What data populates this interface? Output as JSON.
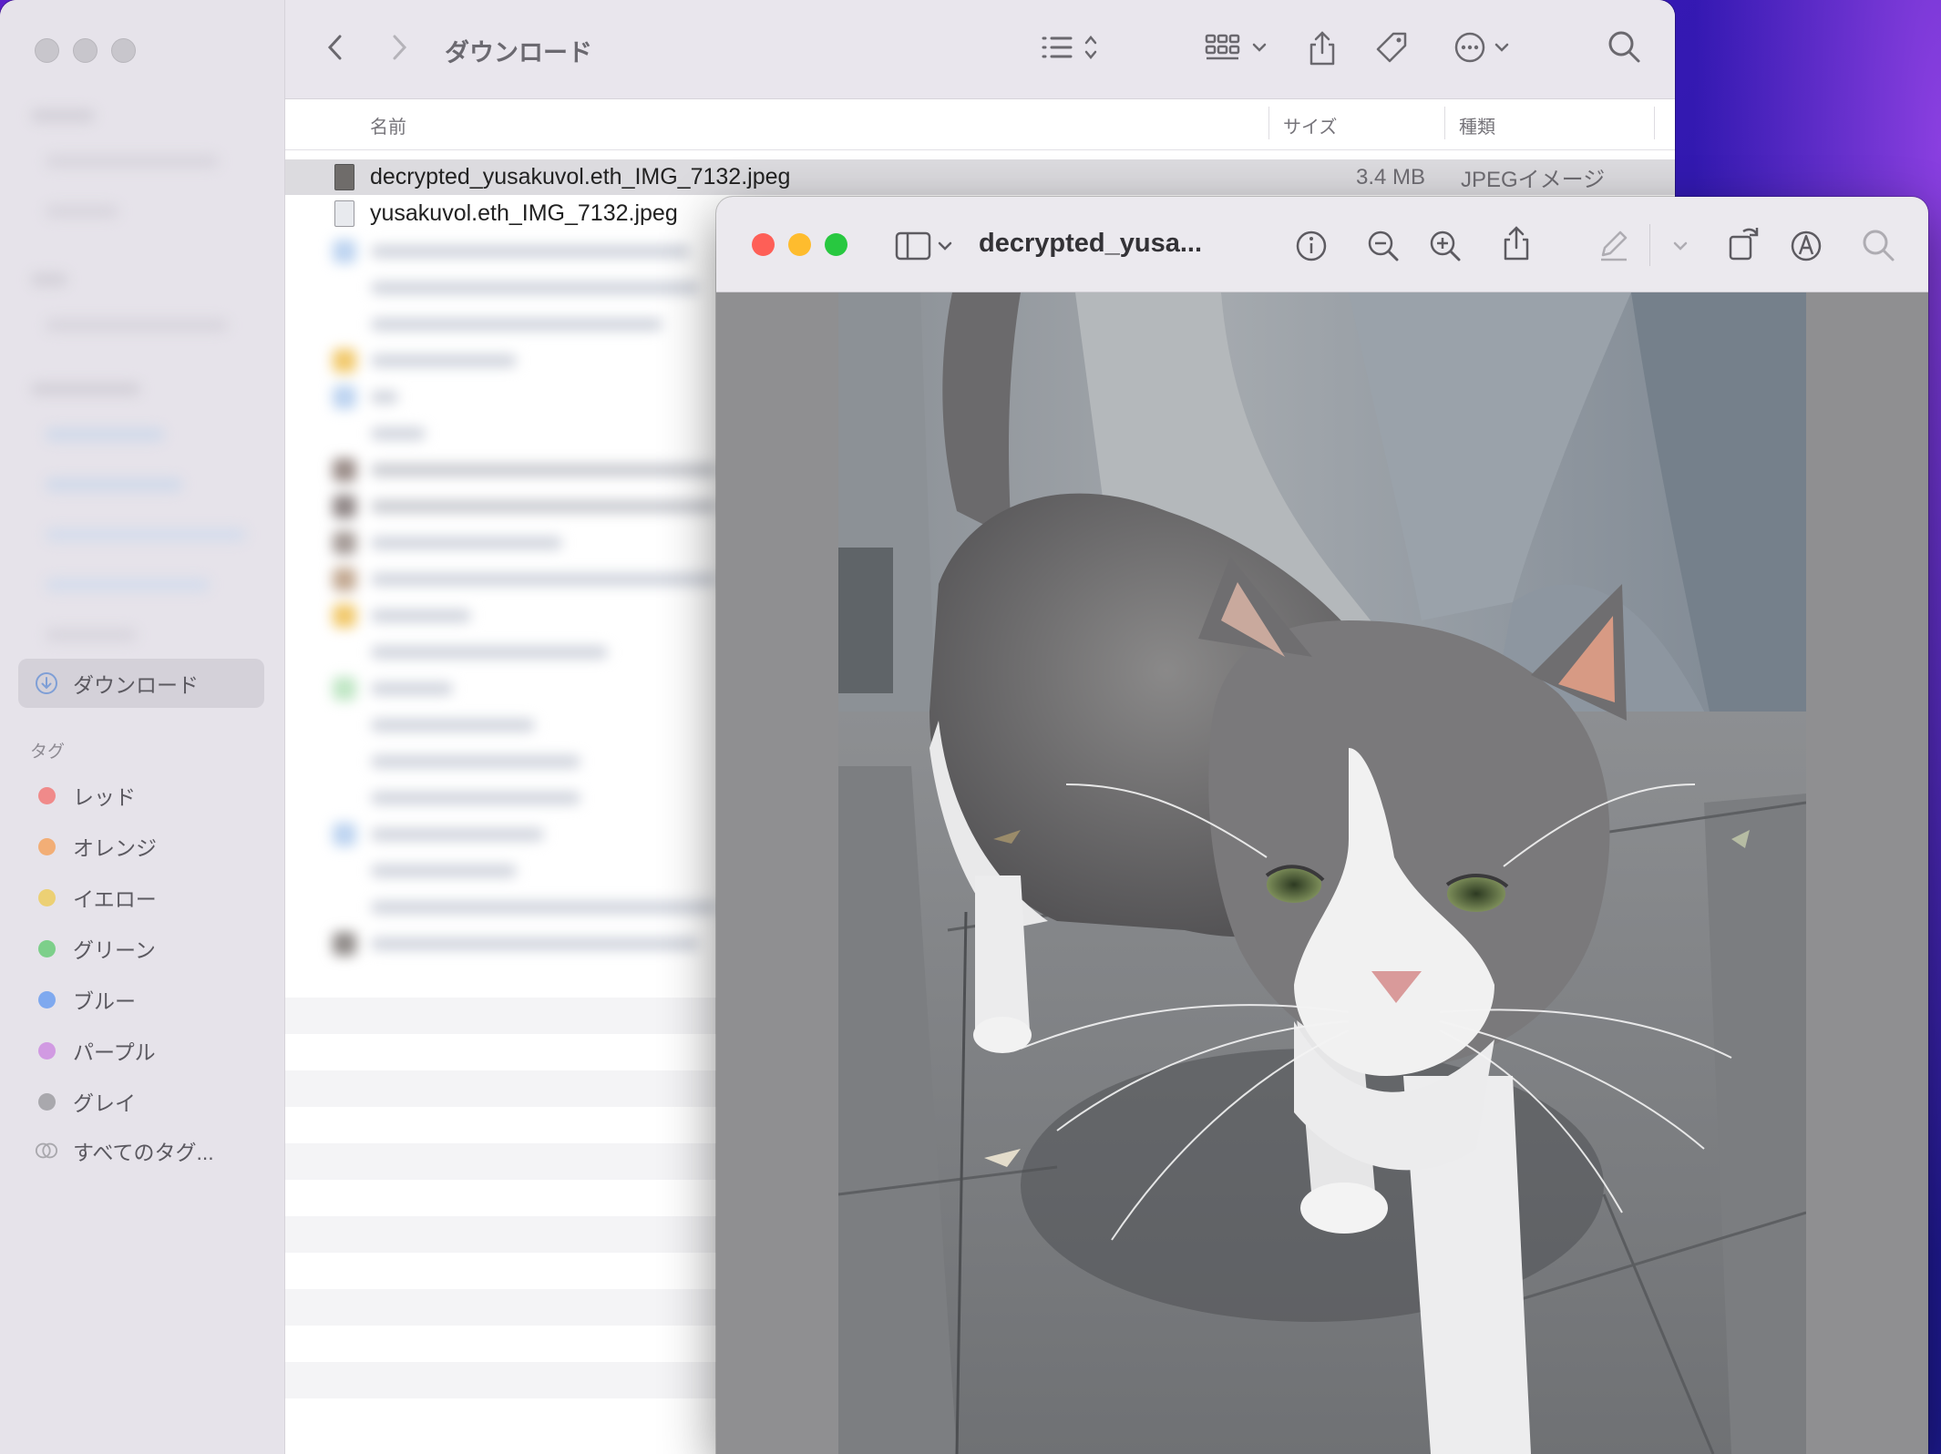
{
  "finder": {
    "location_title": "ダウンロード",
    "sidebar": {
      "selected_item": "ダウンロード",
      "tags_header": "タグ",
      "tags": [
        {
          "label": "レッド",
          "color": "#f08a8a"
        },
        {
          "label": "オレンジ",
          "color": "#f2ae76"
        },
        {
          "label": "イエロー",
          "color": "#ecd074"
        },
        {
          "label": "グリーン",
          "color": "#7dcf8a"
        },
        {
          "label": "ブルー",
          "color": "#7fa9ef"
        },
        {
          "label": "パープル",
          "color": "#d19ae2"
        },
        {
          "label": "グレイ",
          "color": "#a9a8ad"
        }
      ],
      "all_tags": "すべてのタグ..."
    },
    "columns": {
      "name": "名前",
      "size": "サイズ",
      "kind": "種類"
    },
    "files": [
      {
        "name": "decrypted_yusakuvol.eth_IMG_7132.jpeg",
        "size": "3.4 MB",
        "kind": "JPEGイメージ",
        "selected": true
      },
      {
        "name": "yusakuvol.eth_IMG_7132.jpeg",
        "size": "",
        "kind": "",
        "selected": false
      }
    ]
  },
  "preview": {
    "title": "decrypted_yusa...",
    "photo_subject": "gray-and-white-cat-on-pavement"
  }
}
